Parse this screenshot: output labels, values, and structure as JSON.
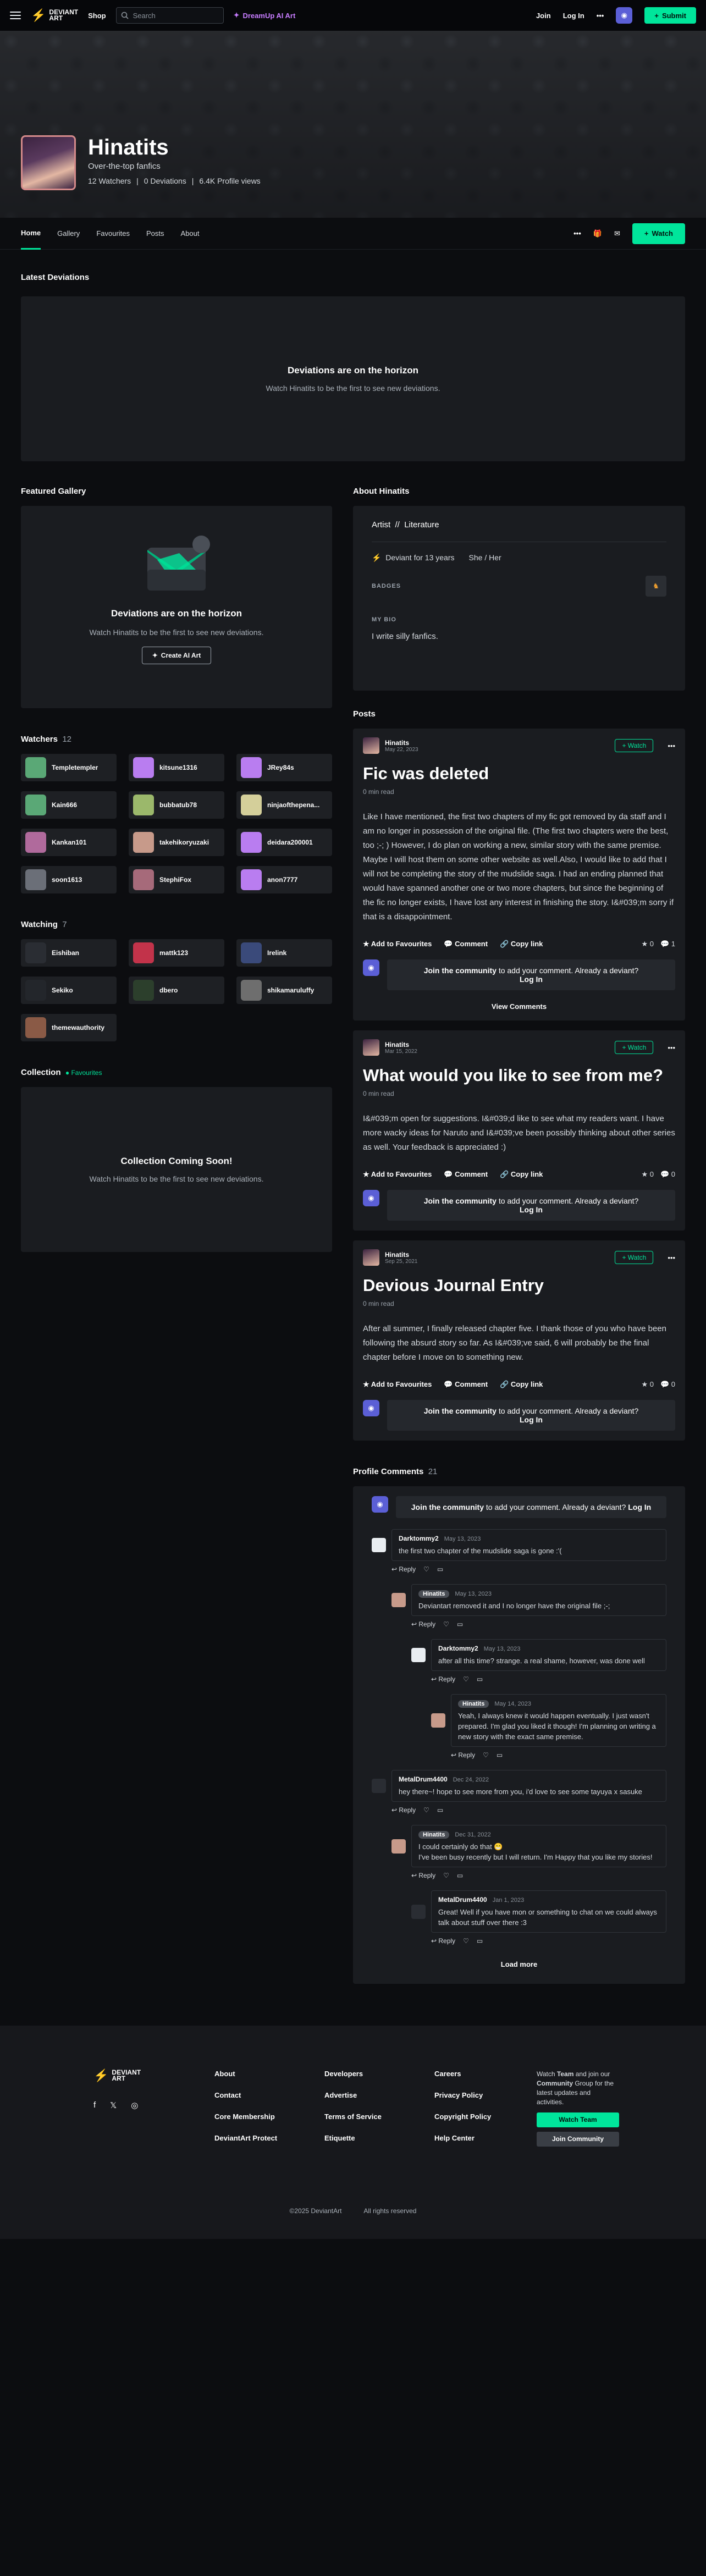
{
  "topnav": {
    "logo": [
      "DEVIANT",
      "ART"
    ],
    "shop": "Shop",
    "search_placeholder": "Search",
    "dreamup": "DreamUp AI Art",
    "join": "Join",
    "login": "Log In",
    "submit": "Submit"
  },
  "profile": {
    "name": "Hinatits",
    "tagline": "Over-the-top fanfics",
    "watchers": "12 Watchers",
    "deviations": "0 Deviations",
    "views": "6.4K Profile views"
  },
  "tabs": [
    "Home",
    "Gallery",
    "Favourites",
    "Posts",
    "About"
  ],
  "watch_label": "Watch",
  "latest": {
    "title": "Latest Deviations",
    "empty_title": "Deviations are on the horizon",
    "empty_sub": "Watch Hinatits to be the first to see new deviations."
  },
  "featured": {
    "title": "Featured Gallery",
    "empty_title": "Deviations are on the horizon",
    "empty_sub": "Watch Hinatits to be the first to see new deviations.",
    "button": "Create AI Art"
  },
  "watchers": {
    "title": "Watchers",
    "count": "12",
    "items": [
      "Templetempler",
      "kitsune1316",
      "JRey84s",
      "Kain666",
      "bubbatub78",
      "ninjaofthepena...",
      "Kankan101",
      "takehikoryuzaki",
      "deidara200001",
      "soon1613",
      "StephiFox",
      "anon7777"
    ],
    "colors": [
      "#5aa876",
      "#b97df0",
      "#b97df0",
      "#5aa876",
      "#9bb86b",
      "#d4cf9a",
      "#b06a9c",
      "#c79a8a",
      "#b97df0",
      "#6b6f78",
      "#a66a7a",
      "#b97df0"
    ]
  },
  "watching": {
    "title": "Watching",
    "count": "7",
    "items": [
      "Eishiban",
      "mattk123",
      "Irelink",
      "Sekiko",
      "dbero",
      "shikamaruluffy",
      "themewauthority"
    ],
    "colors": [
      "#2a2d33",
      "#c2334a",
      "#3a4a7a",
      "#23262b",
      "#2c3f2c",
      "#6e6e6e",
      "#8a5a46"
    ]
  },
  "collection": {
    "title": "Collection",
    "favourites_label": "Favourites",
    "empty_title": "Collection Coming Soon!",
    "empty_sub": "Watch Hinatits to be the first to see new deviations."
  },
  "about": {
    "title": "About Hinatits",
    "role": "Artist",
    "field": "Literature",
    "member_for": "Deviant for 13 years",
    "pronouns": "She / Her",
    "badges_label": "BADGES",
    "bio_label": "MY BIO",
    "bio": "I write silly fanfics."
  },
  "posts": {
    "title": "Posts",
    "items": [
      {
        "author": "Hinatits",
        "date": "May 22, 2023",
        "title": "Fic was deleted",
        "read": "0 min read",
        "body": "Like I have mentioned, the first two chapters of my fic got removed by da staff and I am no longer in possession of the original file. (The first two chapters were the best, too ;-; ) However, I do plan on working a new, similar story with the same premise. Maybe I will host them on some other website as well.Also, I would like to add that I will not be completing the story of the mudslide saga. I had an ending planned that would have spanned another one or two more chapters, but since the beginning of the fic no longer exists, I have lost any interest in finishing the story. I&#039;m sorry if that is a disappointment.",
        "stars": "0",
        "comments": "1",
        "view_comments": "View Comments"
      },
      {
        "author": "Hinatits",
        "date": "Mar 15, 2022",
        "title": "What would you like to see from me?",
        "read": "0 min read",
        "body": "I&#039;m open for suggestions. I&#039;d like to see what my readers want. I have more wacky ideas for Naruto and I&#039;ve been possibly thinking about other series as well. Your feedback is appreciated :)",
        "stars": "0",
        "comments": "0",
        "view_comments": ""
      },
      {
        "author": "Hinatits",
        "date": "Sep 25, 2021",
        "title": "Devious Journal Entry",
        "read": "0 min read",
        "body": "After all summer, I finally released chapter five. I thank those of you who have been following the absurd story so far. As I&#039;ve said, 6 will probably be the final chapter before I move on to something new.",
        "stars": "0",
        "comments": "0",
        "view_comments": ""
      }
    ],
    "add_fav": "Add to Favourites",
    "comment": "Comment",
    "copy_link": "Copy link",
    "join_text": "Join the community",
    "join_tail": "to add your comment. Already a deviant?",
    "login": "Log In"
  },
  "profile_comments": {
    "title": "Profile Comments",
    "count": "21",
    "reply": "Reply",
    "load_more": "Load more",
    "items": [
      {
        "depth": 0,
        "name": "Darktommy2",
        "date": "May 13, 2023",
        "text": "the first two chapter of the mudslide saga is gone :'(",
        "pill": false,
        "color": "#e9edf1"
      },
      {
        "depth": 1,
        "name": "Hinatits",
        "date": "May 13, 2023",
        "text": "Deviantart removed it and I no longer have the original file ;-;",
        "pill": true,
        "color": "#c79a8a"
      },
      {
        "depth": 2,
        "name": "Darktommy2",
        "date": "May 13, 2023",
        "text": "after all this time? strange. a real shame, however, was done well",
        "pill": false,
        "color": "#e9edf1"
      },
      {
        "depth": 3,
        "name": "Hinatits",
        "date": "May 14, 2023",
        "text": "Yeah, I always knew it would happen eventually. I just wasn't prepared. I'm glad you liked it though! I'm planning on writing a new story with the exact same premise.",
        "pill": true,
        "color": "#c79a8a"
      },
      {
        "depth": 0,
        "name": "MetalDrum4400",
        "date": "Dec 24, 2022",
        "text": "hey there~! hope to see more from you, i'd love to see some tayuya x sasuke",
        "pill": false,
        "color": "#2a2d33"
      },
      {
        "depth": 1,
        "name": "Hinatits",
        "date": "Dec 31, 2022",
        "text": "I could certainly do that 😁\nI've been busy recently but I will return. I'm Happy that you like my stories!",
        "pill": true,
        "color": "#c79a8a"
      },
      {
        "depth": 2,
        "name": "MetalDrum4400",
        "date": "Jan 1, 2023",
        "text": "Great! Well if you have mon or something to chat on we could always talk about stuff over there :3",
        "pill": false,
        "color": "#2a2d33"
      }
    ]
  },
  "footer": {
    "cols": [
      [
        "About",
        "Contact",
        "Core Membership",
        "DeviantArt Protect"
      ],
      [
        "Developers",
        "Advertise",
        "Terms of Service",
        "Etiquette"
      ],
      [
        "Careers",
        "Privacy Policy",
        "Copyright Policy",
        "Help Center"
      ]
    ],
    "join_blurb_1": "Watch",
    "join_blurb_team": "Team",
    "join_blurb_2": "and join our",
    "join_blurb_community": "Community",
    "join_blurb_3": "Group for the latest updates and activities.",
    "watch_team": "Watch Team",
    "join_community": "Join Community",
    "copyright": "©2025 DeviantArt",
    "rights": "All rights reserved"
  },
  "colors": {
    "accent": "#00e59b",
    "bg": "#0c0d10",
    "card": "#1a1c20",
    "dreamup": "#c77dff"
  }
}
